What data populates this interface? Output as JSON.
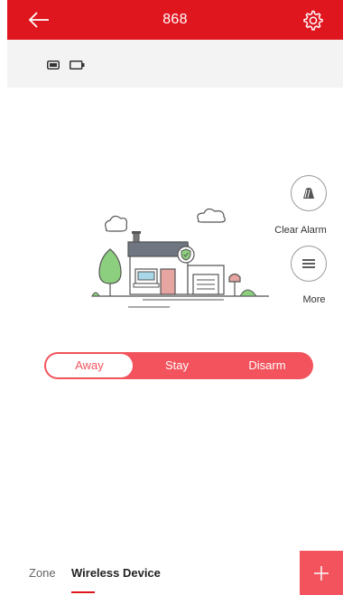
{
  "header": {
    "title": "868",
    "back_icon": "back-arrow-icon",
    "settings_icon": "gear-icon",
    "background_color": "#e0161f"
  },
  "status": {
    "icons": [
      "card-reader-icon",
      "battery-icon"
    ]
  },
  "actions": {
    "clear_alarm_label": "Clear Alarm",
    "more_label": "More"
  },
  "modes": {
    "items": [
      "Away",
      "Stay",
      "Disarm"
    ],
    "selected": "Away",
    "accent_color": "#f2535c"
  },
  "tabs": {
    "items": [
      "Zone",
      "Wireless Device"
    ],
    "selected": "Wireless Device"
  },
  "fab_icon": "plus-icon"
}
